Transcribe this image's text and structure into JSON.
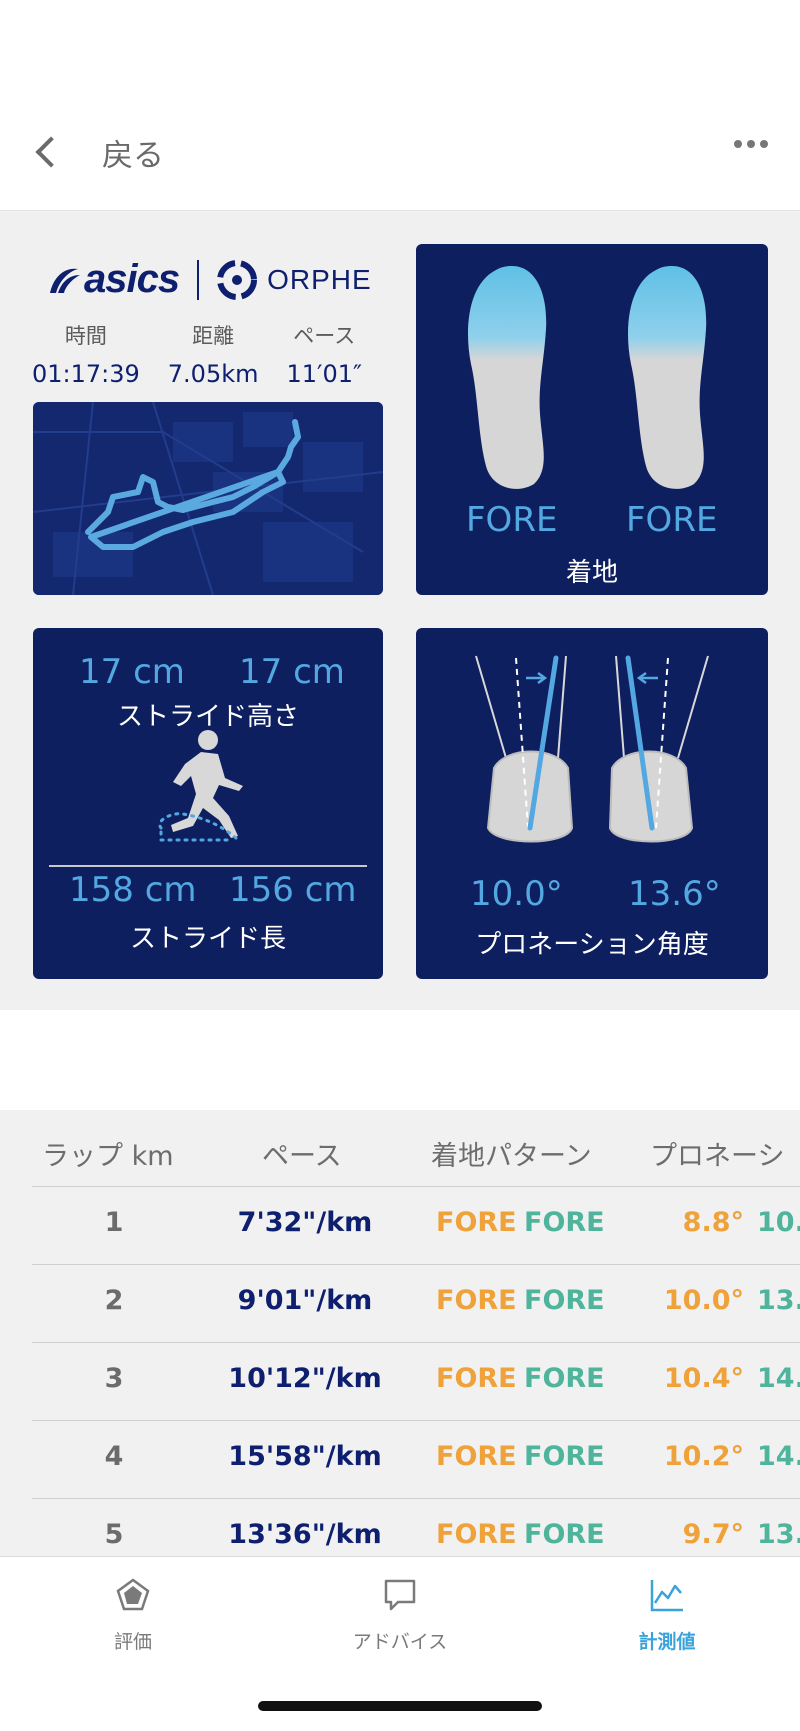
{
  "header": {
    "back_label": "戻る"
  },
  "summary": {
    "brand_asics": "asics",
    "brand_orphe": "ORPHE",
    "stats": [
      {
        "label": "時間",
        "value": "01:17:39"
      },
      {
        "label": "距離",
        "value": "7.05km"
      },
      {
        "label": "ペース",
        "value": "11′01″"
      }
    ],
    "landing": {
      "left": "FORE",
      "right": "FORE",
      "label": "着地"
    },
    "stride": {
      "height_left": "17 cm",
      "height_right": "17 cm",
      "height_label": "ストライド高さ",
      "length_left": "158 cm",
      "length_right": "156 cm",
      "length_label": "ストライド長"
    },
    "pronation": {
      "left": "10.0°",
      "right": "13.6°",
      "label": "プロネーション角度"
    }
  },
  "table": {
    "headers": [
      "ラップ km",
      "ペース",
      "着地パターン",
      "プロネーシ"
    ],
    "rows": [
      {
        "lap": "1",
        "pace": "7'32\"/km",
        "fl": "FORE",
        "fr": "FORE",
        "pl": "8.8°",
        "pr": "10."
      },
      {
        "lap": "2",
        "pace": "9'01\"/km",
        "fl": "FORE",
        "fr": "FORE",
        "pl": "10.0°",
        "pr": "13."
      },
      {
        "lap": "3",
        "pace": "10'12\"/km",
        "fl": "FORE",
        "fr": "FORE",
        "pl": "10.4°",
        "pr": "14."
      },
      {
        "lap": "4",
        "pace": "15'58\"/km",
        "fl": "FORE",
        "fr": "FORE",
        "pl": "10.2°",
        "pr": "14."
      },
      {
        "lap": "5",
        "pace": "13'36\"/km",
        "fl": "FORE",
        "fr": "FORE",
        "pl": "9.7°",
        "pr": "13."
      }
    ]
  },
  "tabs": [
    {
      "label": "評価",
      "icon": "pentagon-chart-icon",
      "active": false
    },
    {
      "label": "アドバイス",
      "icon": "speech-bubble-icon",
      "active": false
    },
    {
      "label": "計測値",
      "icon": "line-chart-icon",
      "active": true
    }
  ],
  "colors": {
    "navy": "#0e1f5f",
    "accent_blue": "#53a8e2",
    "orange": "#efa13a",
    "green": "#4fb49c",
    "tab_active": "#3aa3dc"
  }
}
